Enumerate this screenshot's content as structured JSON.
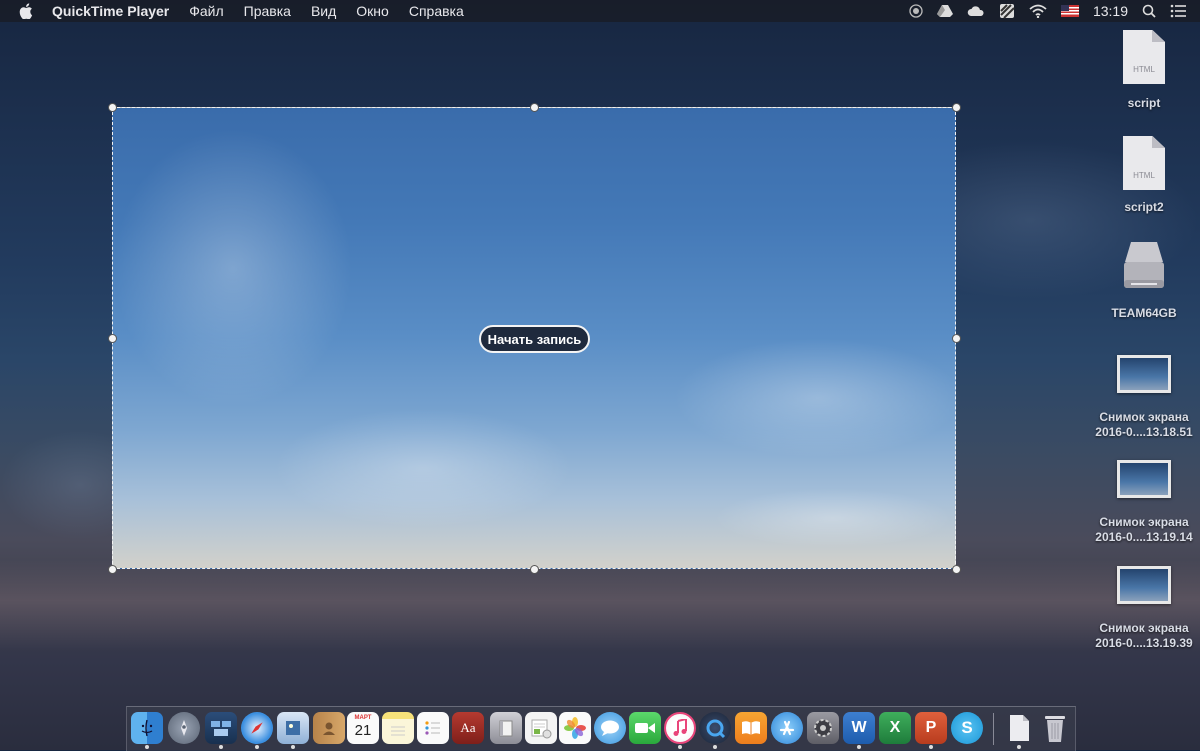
{
  "menubar": {
    "app_name": "QuickTime Player",
    "items": [
      "Файл",
      "Правка",
      "Вид",
      "Окно",
      "Справка"
    ],
    "clock": "13:19"
  },
  "capture": {
    "record_label": "Начать запись"
  },
  "desktop": {
    "icons": [
      {
        "label": "script",
        "ext": "HTML"
      },
      {
        "label": "script2",
        "ext": "HTML"
      },
      {
        "label": "TEAM64GB"
      },
      {
        "label_line1": "Снимок экрана",
        "label_line2": "2016-0....13.18.51"
      },
      {
        "label_line1": "Снимок экрана",
        "label_line2": "2016-0....13.19.14"
      },
      {
        "label_line1": "Снимок экрана",
        "label_line2": "2016-0....13.19.39"
      }
    ]
  },
  "dock": {
    "calendar_month": "МАРТ",
    "calendar_day": "21",
    "dictionary_glyph": "Aa",
    "word_letter": "W",
    "excel_letter": "X",
    "powerpoint_letter": "P",
    "skype_letter": "S"
  }
}
